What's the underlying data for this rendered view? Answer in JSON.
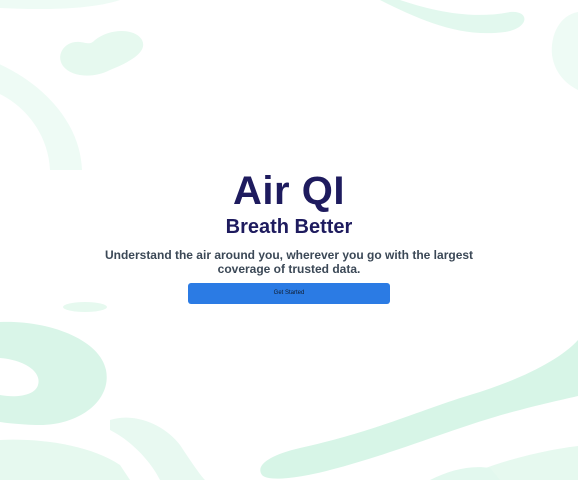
{
  "hero": {
    "title": "Air QI",
    "subtitle": "Breath Better",
    "description": "Understand the air around you, wherever you go with the largest coverage of trusted data.",
    "cta_label": "Get Started"
  },
  "colors": {
    "title": "#1e1b5e",
    "description": "#3b4856",
    "button": "#2b7be4",
    "decor_light": "#eafaf3",
    "decor_mid": "#d4f3e6"
  }
}
